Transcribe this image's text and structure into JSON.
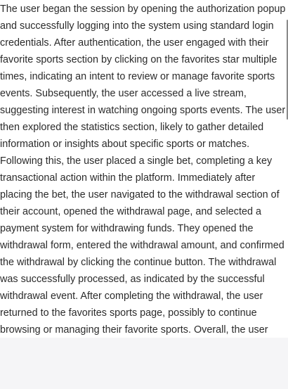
{
  "summary": {
    "text": "The user began the session by opening the authorization popup and successfully logging into the system using standard login credentials. After authentication, the user engaged with their favorite sports section by clicking on the favorites star multiple times, indicating an intent to review or manage favorite sports events. Subsequently, the user accessed a live stream, suggesting interest in watching ongoing sports events. The user then explored the statistics section, likely to gather detailed information or insights about specific sports or matches. Following this, the user placed a single bet, completing a key transactional action within the platform. Immediately after placing the bet, the user navigated to the withdrawal section of their account, opened the withdrawal page, and selected a payment system for withdrawing funds. They opened the withdrawal form, entered the withdrawal amount, and confirmed the withdrawal by clicking the continue button. The withdrawal was successfully processed, as indicated by the successful withdrawal event. After completing the withdrawal, the user returned to the favorites sports page, possibly to continue browsing or managing their favorite sports. Overall, the user"
  },
  "colors": {
    "text": "#2b2b2b",
    "background": "#ffffff",
    "footer": "#f5f5f7",
    "scrollbar_thumb": "#8a8a8a"
  }
}
